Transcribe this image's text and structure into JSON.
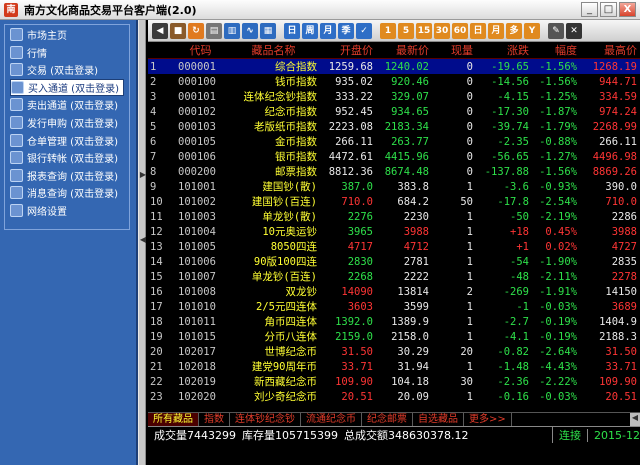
{
  "window": {
    "title": "南方文化商品交易平台客户端(2.0)",
    "icon_letter": "南"
  },
  "winbuttons": [
    "_",
    "□",
    "X"
  ],
  "sidebar": {
    "items": [
      {
        "label": "市场主页",
        "selected": false
      },
      {
        "label": "行情",
        "selected": false
      },
      {
        "label": "交易 (双击登录)",
        "selected": false
      },
      {
        "label": "买入通道 (双击登录)",
        "selected": true
      },
      {
        "label": "卖出通道 (双击登录)",
        "selected": false
      },
      {
        "label": "发行申购 (双击登录)",
        "selected": false
      },
      {
        "label": "仓单管理 (双击登录)",
        "selected": false
      },
      {
        "label": "银行转帐 (双击登录)",
        "selected": false
      },
      {
        "label": "报表查询 (双击登录)",
        "selected": false
      },
      {
        "label": "消息查询 (双击登录)",
        "selected": false
      },
      {
        "label": "网络设置",
        "selected": false
      }
    ]
  },
  "toolbar": {
    "buttons": [
      {
        "icon": "arrow-left-icon",
        "text": "◀",
        "color": "#3b3b3b"
      },
      {
        "icon": "cube-icon",
        "text": "■",
        "color": "#8a5a2a"
      },
      {
        "icon": "refresh-icon",
        "text": "↻",
        "color": "#e07a1f"
      },
      {
        "icon": "document-icon",
        "text": "▤",
        "color": "#777777"
      },
      {
        "icon": "chart-icon",
        "text": "▥",
        "color": "#2d6bbf"
      },
      {
        "icon": "line-chart-icon",
        "text": "∿",
        "color": "#2d6bbf"
      },
      {
        "icon": "grid-icon",
        "text": "▦",
        "color": "#2d6bbf"
      },
      {
        "icon": "day-icon",
        "text": "日",
        "color": "#2e6ec6"
      },
      {
        "icon": "week-icon",
        "text": "周",
        "color": "#2e6ec6"
      },
      {
        "icon": "month-icon",
        "text": "月",
        "color": "#2e6ec6"
      },
      {
        "icon": "season-icon",
        "text": "季",
        "color": "#2e6ec6"
      },
      {
        "icon": "bookmark-icon",
        "text": "✓",
        "color": "#2e6ec6"
      },
      {
        "icon": "min1-icon",
        "text": "1",
        "color": "#e08a1f"
      },
      {
        "icon": "min5-icon",
        "text": "5",
        "color": "#e08a1f"
      },
      {
        "icon": "min15-icon",
        "text": "15",
        "color": "#e08a1f"
      },
      {
        "icon": "min30-icon",
        "text": "30",
        "color": "#e08a1f"
      },
      {
        "icon": "min60-icon",
        "text": "60",
        "color": "#e08a1f"
      },
      {
        "icon": "day-k-icon",
        "text": "日",
        "color": "#e08a1f"
      },
      {
        "icon": "month-k-icon",
        "text": "月",
        "color": "#e08a1f"
      },
      {
        "icon": "multi-icon",
        "text": "多",
        "color": "#e08a1f"
      },
      {
        "icon": "formula-icon",
        "text": "Y",
        "color": "#e08a1f"
      },
      {
        "icon": "draw-icon",
        "text": "✎",
        "color": "#555555"
      },
      {
        "icon": "close-tool-icon",
        "text": "✕",
        "color": "#333333"
      }
    ]
  },
  "table": {
    "headers": [
      "",
      "代码",
      "藏品名称",
      "开盘价",
      "最新价",
      "现量",
      "涨跌",
      "幅度",
      "最高价"
    ],
    "rows": [
      {
        "idx": "1",
        "code": "000001",
        "name": "综合指数",
        "open": "1259.68",
        "last": "1240.02",
        "vol": "0",
        "chg": "-19.65",
        "pct": "-1.56%",
        "high": "1268.19",
        "oc": "flat",
        "lc": "down",
        "cc": "down",
        "hc": "up"
      },
      {
        "idx": "2",
        "code": "000100",
        "name": "钱币指数",
        "open": "935.02",
        "last": "920.46",
        "vol": "0",
        "chg": "-14.56",
        "pct": "-1.56%",
        "high": "944.71",
        "oc": "flat",
        "lc": "down",
        "cc": "down",
        "hc": "up"
      },
      {
        "idx": "3",
        "code": "000101",
        "name": "连体纪念钞指数",
        "open": "333.22",
        "last": "329.07",
        "vol": "0",
        "chg": "-4.15",
        "pct": "-1.25%",
        "high": "334.59",
        "oc": "flat",
        "lc": "down",
        "cc": "down",
        "hc": "up"
      },
      {
        "idx": "4",
        "code": "000102",
        "name": "纪念币指数",
        "open": "952.45",
        "last": "934.65",
        "vol": "0",
        "chg": "-17.30",
        "pct": "-1.87%",
        "high": "974.24",
        "oc": "flat",
        "lc": "down",
        "cc": "down",
        "hc": "up"
      },
      {
        "idx": "5",
        "code": "000103",
        "name": "老版纸币指数",
        "open": "2223.08",
        "last": "2183.34",
        "vol": "0",
        "chg": "-39.74",
        "pct": "-1.79%",
        "high": "2268.99",
        "oc": "flat",
        "lc": "down",
        "cc": "down",
        "hc": "up"
      },
      {
        "idx": "6",
        "code": "000105",
        "name": "金币指数",
        "open": "266.11",
        "last": "263.77",
        "vol": "0",
        "chg": "-2.35",
        "pct": "-0.88%",
        "high": "266.11",
        "oc": "flat",
        "lc": "down",
        "cc": "down",
        "hc": "flat"
      },
      {
        "idx": "7",
        "code": "000106",
        "name": "银币指数",
        "open": "4472.61",
        "last": "4415.96",
        "vol": "0",
        "chg": "-56.65",
        "pct": "-1.27%",
        "high": "4496.98",
        "oc": "flat",
        "lc": "down",
        "cc": "down",
        "hc": "up"
      },
      {
        "idx": "8",
        "code": "000200",
        "name": "邮票指数",
        "open": "8812.36",
        "last": "8674.48",
        "vol": "0",
        "chg": "-137.88",
        "pct": "-1.56%",
        "high": "8869.26",
        "oc": "flat",
        "lc": "down",
        "cc": "down",
        "hc": "up"
      },
      {
        "idx": "9",
        "code": "101001",
        "name": "建国钞(散)",
        "open": "387.0",
        "last": "383.8",
        "vol": "1",
        "chg": "-3.6",
        "pct": "-0.93%",
        "high": "390.0",
        "oc": "down",
        "lc": "flat",
        "cc": "down",
        "hc": "flat"
      },
      {
        "idx": "10",
        "code": "101002",
        "name": "建国钞(百连)",
        "open": "710.0",
        "last": "684.2",
        "vol": "50",
        "chg": "-17.8",
        "pct": "-2.54%",
        "high": "710.0",
        "oc": "up",
        "lc": "flat",
        "cc": "down",
        "hc": "up"
      },
      {
        "idx": "11",
        "code": "101003",
        "name": "单龙钞(散)",
        "open": "2276",
        "last": "2230",
        "vol": "1",
        "chg": "-50",
        "pct": "-2.19%",
        "high": "2286",
        "oc": "down",
        "lc": "flat",
        "cc": "down",
        "hc": "flat"
      },
      {
        "idx": "12",
        "code": "101004",
        "name": "10元奥运钞",
        "open": "3965",
        "last": "3988",
        "vol": "1",
        "chg": "+18",
        "pct": "0.45%",
        "high": "3988",
        "oc": "down",
        "lc": "up",
        "cc": "up",
        "hc": "up"
      },
      {
        "idx": "13",
        "code": "101005",
        "name": "8050四连",
        "open": "4717",
        "last": "4712",
        "vol": "1",
        "chg": "+1",
        "pct": "0.02%",
        "high": "4727",
        "oc": "up",
        "lc": "up",
        "cc": "up",
        "hc": "up"
      },
      {
        "idx": "14",
        "code": "101006",
        "name": "90版100四连",
        "open": "2830",
        "last": "2781",
        "vol": "1",
        "chg": "-54",
        "pct": "-1.90%",
        "high": "2835",
        "oc": "down",
        "lc": "flat",
        "cc": "down",
        "hc": "flat"
      },
      {
        "idx": "15",
        "code": "101007",
        "name": "单龙钞(百连)",
        "open": "2268",
        "last": "2222",
        "vol": "1",
        "chg": "-48",
        "pct": "-2.11%",
        "high": "2278",
        "oc": "down",
        "lc": "flat",
        "cc": "down",
        "hc": "up"
      },
      {
        "idx": "16",
        "code": "101008",
        "name": "双龙钞",
        "open": "14090",
        "last": "13814",
        "vol": "2",
        "chg": "-269",
        "pct": "-1.91%",
        "high": "14150",
        "oc": "up",
        "lc": "flat",
        "cc": "down",
        "hc": "flat"
      },
      {
        "idx": "17",
        "code": "101010",
        "name": "2/5元四连体",
        "open": "3603",
        "last": "3599",
        "vol": "1",
        "chg": "-1",
        "pct": "-0.03%",
        "high": "3689",
        "oc": "up",
        "lc": "flat",
        "cc": "down",
        "hc": "up"
      },
      {
        "idx": "18",
        "code": "101011",
        "name": "角币四连体",
        "open": "1392.0",
        "last": "1389.9",
        "vol": "1",
        "chg": "-2.7",
        "pct": "-0.19%",
        "high": "1404.9",
        "oc": "down",
        "lc": "flat",
        "cc": "down",
        "hc": "flat"
      },
      {
        "idx": "19",
        "code": "101015",
        "name": "分币八连体",
        "open": "2159.0",
        "last": "2158.0",
        "vol": "1",
        "chg": "-4.1",
        "pct": "-0.19%",
        "high": "2188.3",
        "oc": "down",
        "lc": "flat",
        "cc": "down",
        "hc": "flat"
      },
      {
        "idx": "20",
        "code": "102017",
        "name": "世博纪念币",
        "open": "31.50",
        "last": "30.29",
        "vol": "20",
        "chg": "-0.82",
        "pct": "-2.64%",
        "high": "31.50",
        "oc": "up",
        "lc": "flat",
        "cc": "down",
        "hc": "up"
      },
      {
        "idx": "21",
        "code": "102018",
        "name": "建党90周年币",
        "open": "33.71",
        "last": "31.94",
        "vol": "1",
        "chg": "-1.48",
        "pct": "-4.43%",
        "high": "33.71",
        "oc": "up",
        "lc": "flat",
        "cc": "down",
        "hc": "up"
      },
      {
        "idx": "22",
        "code": "102019",
        "name": "新西藏纪念币",
        "open": "109.90",
        "last": "104.18",
        "vol": "30",
        "chg": "-2.36",
        "pct": "-2.22%",
        "high": "109.90",
        "oc": "up",
        "lc": "flat",
        "cc": "down",
        "hc": "up"
      },
      {
        "idx": "23",
        "code": "102020",
        "name": "刘少奇纪念币",
        "open": "20.51",
        "last": "20.09",
        "vol": "1",
        "chg": "-0.16",
        "pct": "-0.03%",
        "high": "20.51",
        "oc": "up",
        "lc": "flat",
        "cc": "down",
        "hc": "up"
      }
    ]
  },
  "tabs": {
    "items": [
      {
        "label": "所有藏品",
        "active": true
      },
      {
        "label": "指数",
        "active": false
      },
      {
        "label": "连体钞纪念钞",
        "active": false
      },
      {
        "label": "流通纪念币",
        "active": false
      },
      {
        "label": "纪念邮票",
        "active": false
      },
      {
        "label": "自选藏品",
        "active": false
      },
      {
        "label": "更多>>",
        "active": false
      }
    ]
  },
  "status": {
    "volume": "成交量7443299",
    "stock": "库存量105715399",
    "amount": "总成交额348630378.12",
    "connection": "连接",
    "date": "2015-12"
  }
}
